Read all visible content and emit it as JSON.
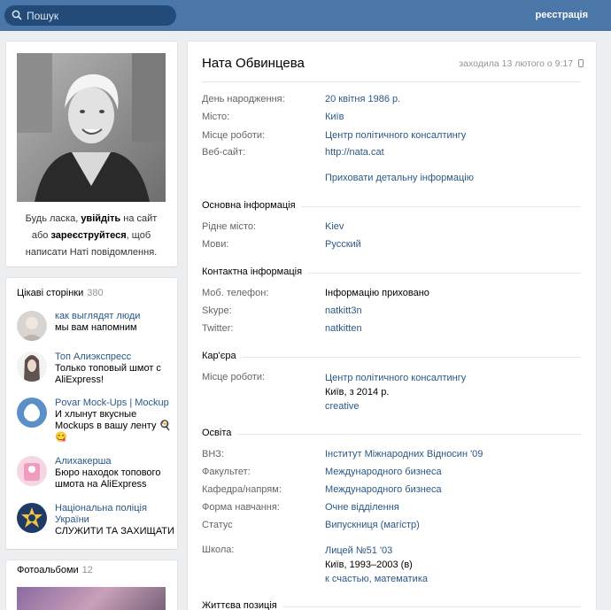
{
  "header": {
    "search_placeholder": "Пошук",
    "register_label": "реєстрація"
  },
  "login_prompt": {
    "part1": "Будь ласка, ",
    "login_link": "увійдіть",
    "part2": " на сайт або ",
    "register_link": "зареєструйтеся",
    "part3": ", щоб написати Наті повідомлення."
  },
  "pages": {
    "title": "Цікаві сторінки",
    "count": "380",
    "items": [
      {
        "name": "как выглядят люди",
        "desc": "мы вам напомним"
      },
      {
        "name": "Топ Алиэкспресс",
        "desc": "Только топовый шмот с AliExpress!"
      },
      {
        "name": "Povar Mock-Ups | Mockup",
        "desc": "И хлынут вкусные Mockups в вашу ленту 🍳😋"
      },
      {
        "name": "Алихакерша",
        "desc": "Бюро находок топового шмота на AliExpress"
      },
      {
        "name": "Національна поліція України",
        "desc": "СЛУЖИТИ ТА ЗАХИЩАТИ"
      }
    ]
  },
  "albums": {
    "title": "Фотоальбоми",
    "count": "12"
  },
  "profile": {
    "name": "Ната Обвинцева",
    "last_seen": "заходила 13 лютого о 9:17",
    "basic": [
      {
        "label": "День народження:",
        "value": "20 квітня 1986 р."
      },
      {
        "label": "Місто:",
        "value": "Київ"
      },
      {
        "label": "Місце роботи:",
        "value": "Центр політичного консалтингу"
      },
      {
        "label": "Веб-сайт:",
        "value": "http://nata.cat"
      }
    ],
    "hide_details": "Приховати детальну інформацію",
    "main_info": {
      "title": "Основна інформація",
      "rows": [
        {
          "label": "Рідне місто:",
          "value": "Kiev"
        },
        {
          "label": "Мови:",
          "value": "Русский"
        }
      ]
    },
    "contacts": {
      "title": "Контактна інформація",
      "rows": [
        {
          "label": "Моб. телефон:",
          "value": "Інформацію приховано"
        },
        {
          "label": "Skype:",
          "value": "natkitt3n"
        },
        {
          "label": "Twitter:",
          "value": "natkitten"
        }
      ]
    },
    "career": {
      "title": "Кар'єра",
      "label": "Місце роботи:",
      "company": "Центр політичного консалтингу",
      "period": "Київ, з 2014 р.",
      "position": "creative"
    },
    "education": {
      "title": "Освіта",
      "rows": [
        {
          "label": "ВНЗ:",
          "value": "Інститут Міжнародних Відносин '09"
        },
        {
          "label": "Факультет:",
          "value": "Международного бизнеса"
        },
        {
          "label": "Кафедра/напрям:",
          "value": "Международного бизнеса"
        },
        {
          "label": "Форма навчання:",
          "value": "Очне відділення"
        },
        {
          "label": "Статус",
          "value": "Випускниця (магістр)"
        }
      ],
      "school_label": "Школа:",
      "school_name": "Лицей №51 '03",
      "school_period": "Київ, 1993–2003 (в)",
      "school_spec": "к счастью, математика"
    },
    "life_position": {
      "title": "Життєва позиція"
    }
  },
  "colors": {
    "header": "#4a76a8",
    "link": "#2a5885",
    "label": "#656565",
    "bg": "#edeef0"
  }
}
